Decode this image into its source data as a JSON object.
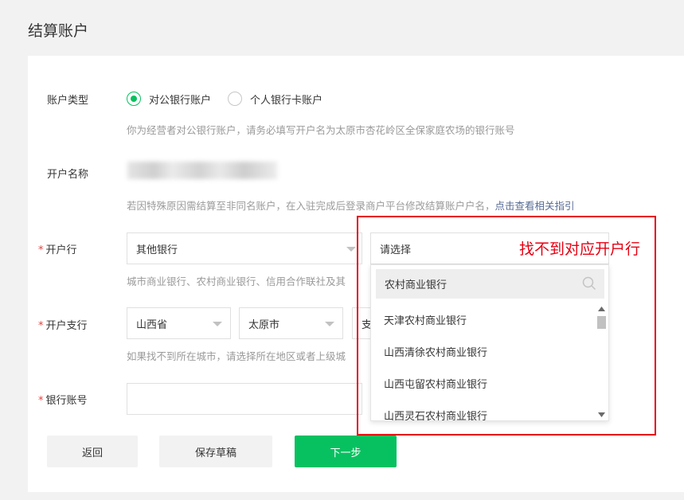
{
  "page": {
    "title": "结算账户"
  },
  "account_type": {
    "label": "账户类型",
    "option_public": "对公银行账户",
    "option_personal": "个人银行卡账户",
    "hint": "你为经营者对公银行账户，请务必填写开户名为太原市杏花岭区全保家庭农场的银行账号"
  },
  "account_name": {
    "label": "开户名称",
    "hint": "若因特殊原因需结算至非同名账户，在入驻完成后登录商户平台修改结算账户户名，",
    "hint_link": "点击查看相关指引"
  },
  "bank": {
    "required_mark": "*",
    "label": "开户行",
    "bank_select": "其他银行",
    "bank_detail_placeholder": "请选择",
    "hint": "城市商业银行、农村商业银行、信用合作联社及其"
  },
  "branch": {
    "required_mark": "*",
    "label": "开户支行",
    "province": "山西省",
    "city": "太原市",
    "branch_partial": "支",
    "hint": "如果找不到所在城市，请选择所在地区或者上级城"
  },
  "bank_account": {
    "required_mark": "*",
    "label": "银行账号",
    "value": ""
  },
  "buttons": {
    "back": "返回",
    "save_draft": "保存草稿",
    "next": "下一步"
  },
  "dropdown": {
    "search_value": "农村商业银行",
    "search_icon": "search-icon",
    "items": [
      "天津农村商业银行",
      "山西清徐农村商业银行",
      "山西屯留农村商业银行",
      "山西灵石农村商业银行"
    ]
  },
  "annotation": {
    "text": "找不到对应开户行",
    "color": "#e60012"
  },
  "colors": {
    "accent": "#07c160",
    "link": "#576b95",
    "required": "#e64340"
  }
}
